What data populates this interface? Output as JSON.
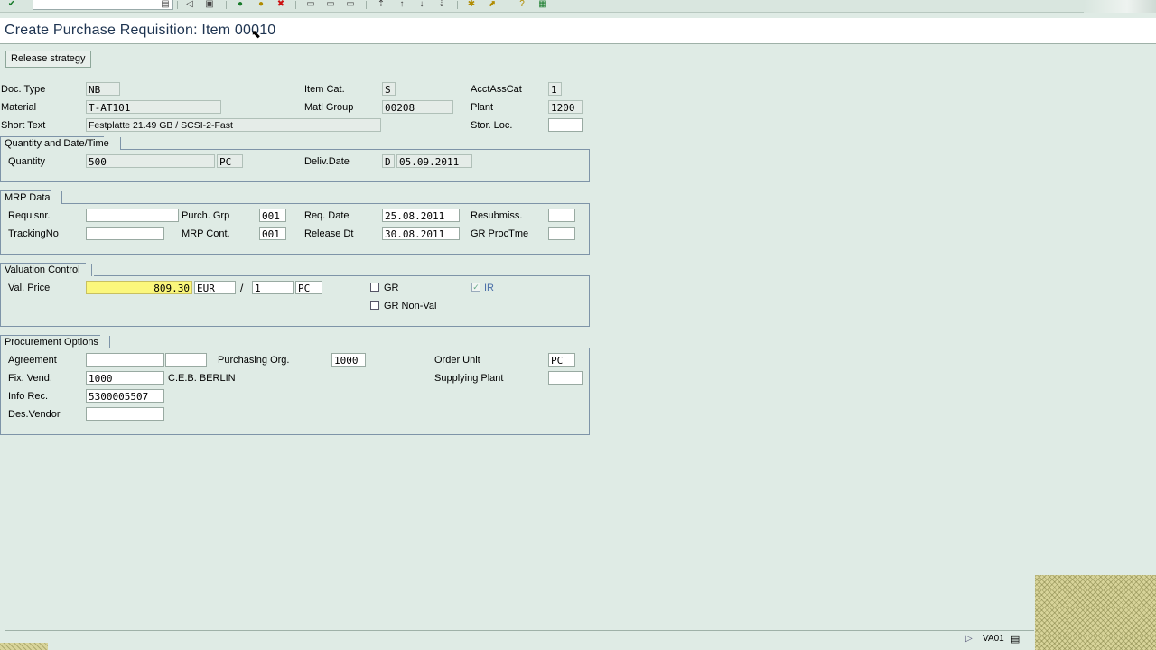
{
  "title": "Create Purchase Requisition: Item 00010",
  "app_toolbar": {
    "release_strategy": "Release strategy"
  },
  "header": {
    "doc_type": {
      "label": "Doc. Type",
      "value": "NB"
    },
    "material": {
      "label": "Material",
      "value": "T-AT101"
    },
    "short_text": {
      "label": "Short Text",
      "value": "Festplatte 21.49 GB / SCSI-2-Fast"
    },
    "item_cat": {
      "label": "Item Cat.",
      "value": "S"
    },
    "matl_group": {
      "label": "Matl Group",
      "value": "00208"
    },
    "acct_ass_cat": {
      "label": "AcctAssCat",
      "value": "1"
    },
    "plant": {
      "label": "Plant",
      "value": "1200"
    },
    "stor_loc": {
      "label": "Stor. Loc.",
      "value": ""
    }
  },
  "quantity": {
    "title": "Quantity and Date/Time",
    "quantity": {
      "label": "Quantity",
      "value": "500",
      "unit": "PC"
    },
    "deliv_date": {
      "label": "Deliv.Date",
      "format": "D",
      "value": "05.09.2011"
    }
  },
  "mrp": {
    "title": "MRP Data",
    "requisnr": {
      "label": "Requisnr.",
      "value": ""
    },
    "tracking_no": {
      "label": "TrackingNo",
      "value": ""
    },
    "purch_grp": {
      "label": "Purch. Grp",
      "value": "001"
    },
    "mrp_cont": {
      "label": "MRP Cont.",
      "value": "001"
    },
    "req_date": {
      "label": "Req. Date",
      "value": "25.08.2011"
    },
    "release_dt": {
      "label": "Release Dt",
      "value": "30.08.2011"
    },
    "resubmiss": {
      "label": "Resubmiss.",
      "value": ""
    },
    "gr_proc_time": {
      "label": "GR ProcTme",
      "value": ""
    }
  },
  "valuation": {
    "title": "Valuation Control",
    "val_price": {
      "label": "Val. Price",
      "value": "809.30",
      "currency": "EUR",
      "slash": "/",
      "per": "1",
      "unit": "PC"
    },
    "gr": {
      "label": "GR",
      "checked": false
    },
    "gr_non_val": {
      "label": "GR Non-Val",
      "checked": false
    },
    "ir": {
      "label": "IR",
      "checked": true
    }
  },
  "procurement": {
    "title": "Procurement Options",
    "agreement": {
      "label": "Agreement",
      "value": "",
      "item": ""
    },
    "purchasing_org": {
      "label": "Purchasing Org.",
      "value": "1000"
    },
    "order_unit": {
      "label": "Order Unit",
      "value": "PC"
    },
    "fix_vend": {
      "label": "Fix. Vend.",
      "value": "1000",
      "name": "C.E.B. BERLIN"
    },
    "supplying_plant": {
      "label": "Supplying Plant",
      "value": ""
    },
    "info_rec": {
      "label": "Info Rec.",
      "value": "5300005507"
    },
    "des_vendor": {
      "label": "Des.Vendor",
      "value": ""
    }
  },
  "status": {
    "transaction": "VA01"
  }
}
